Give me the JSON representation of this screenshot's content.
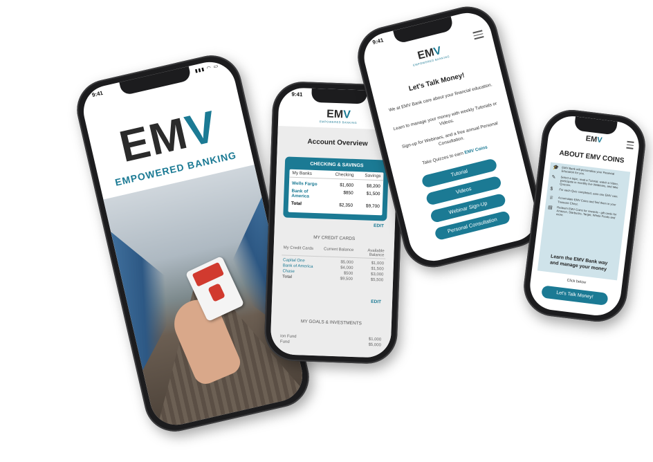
{
  "status": {
    "time": "9:41"
  },
  "brand": {
    "logo_text_main": "EM",
    "logo_text_accent": "V",
    "tagline": "EMPOWERED BANKING",
    "tagline_small": "EMPOWERED BANKING"
  },
  "account_overview": {
    "title": "Account Overview",
    "checking_savings": {
      "header": "CHECKING & SAVINGS",
      "columns": [
        "My Banks",
        "Checking",
        "Savings"
      ],
      "rows": [
        {
          "name": "Wells Fargo",
          "checking": "$1,600",
          "savings": "$8,200"
        },
        {
          "name": "Bank of America",
          "checking": "$850",
          "savings": "$1,500"
        },
        {
          "name": "Total",
          "checking": "$2,350",
          "savings": "$9,700"
        }
      ],
      "edit_label": "EDIT"
    },
    "credit_cards": {
      "header": "MY CREDIT CARDS",
      "columns": [
        "My Credit Cards",
        "Current Balance",
        "Available Balance"
      ],
      "rows": [
        {
          "name": "Capital One",
          "current": "$5,000",
          "available": "$1,000"
        },
        {
          "name": "Bank of America",
          "current": "$4,000",
          "available": "$1,500"
        },
        {
          "name": "Chase",
          "current": "$500",
          "available": "$3,000"
        },
        {
          "name": "Total",
          "current": "$9,500",
          "available": "$5,500"
        }
      ],
      "edit_label": "EDIT"
    },
    "goals": {
      "header": "MY GOALS & INVESTMENTS",
      "rows": [
        {
          "name": "ion Fund",
          "value": "$1,000"
        },
        {
          "name": "Fund",
          "value": "$5,000"
        }
      ]
    }
  },
  "talk_money": {
    "title": "Let's Talk Money!",
    "paragraphs": [
      "We at EMV Bank care about your financial education.",
      "Learn to manage your money with weekly Tutorials or Videos.",
      "Sign-up for Webinars, and a free annual Personal Consultation."
    ],
    "quiz_text": "Take Quizzes to earn",
    "quiz_link": "EMV Coins",
    "buttons": [
      "Tutorial",
      "Videos",
      "Webinar Sign-Up",
      "Personal Consultation"
    ]
  },
  "about_coins": {
    "title": "ABOUT EMV COINS",
    "items": [
      {
        "icon": "graduation-cap-icon",
        "glyph": "🎓",
        "text": "EMV Bank will personalize your Financial Education for you."
      },
      {
        "icon": "pointer-icon",
        "glyph": "✎",
        "text": "Select a topic, read a Tutorial, watch a Video, participate in monthly live Webinars, and take Quizzes."
      },
      {
        "icon": "coin-icon",
        "glyph": "$",
        "text": "For each Quiz completed, earn one EMV coin."
      },
      {
        "icon": "treasure-icon",
        "glyph": "♕",
        "text": "Accumulate EMV Coins and find them in your Treasure Chest."
      },
      {
        "icon": "gift-card-icon",
        "glyph": "▤",
        "text": "Redeem EMV Coins for rewards - gift cards for Amazon, Starbucks, Target, Whole Foods and more."
      }
    ],
    "cta_line1": "Learn the EMV Bank way",
    "cta_line2": "and manage your money",
    "click_below": "Click below",
    "button": "Let's Talk Money!"
  },
  "colors": {
    "accent": "#1b7a94",
    "dark": "#2b2b2b",
    "panel": "#cfe3ea"
  }
}
